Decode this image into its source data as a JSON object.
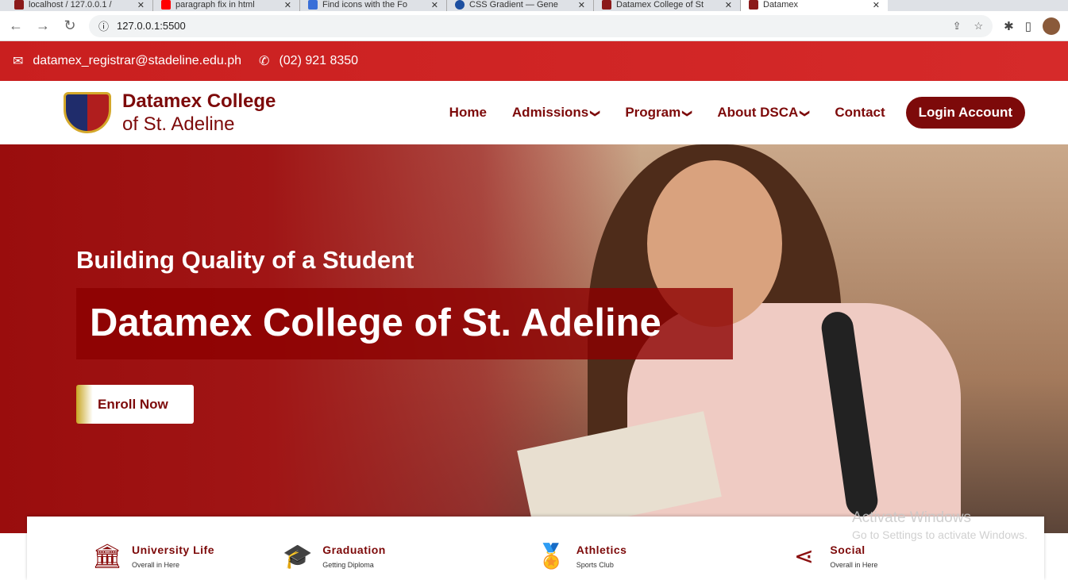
{
  "browser": {
    "tabs": [
      {
        "label": "localhost / 127.0.0.1 /"
      },
      {
        "label": "paragraph fix in html"
      },
      {
        "label": "Find icons with the Fo"
      },
      {
        "label": "CSS Gradient — Gene"
      },
      {
        "label": "Datamex College of St"
      },
      {
        "label": "Datamex",
        "active": true
      }
    ],
    "url": "127.0.0.1:5500"
  },
  "topbar": {
    "email": "datamex_registrar@stadeline.edu.ph",
    "phone": "(02) 921 8350"
  },
  "header": {
    "brand_line1": "Datamex College",
    "brand_line2": "of St. Adeline",
    "menu": [
      {
        "label": "Home"
      },
      {
        "label": "Admissions"
      },
      {
        "label": "Program"
      },
      {
        "label": "About DSCA"
      },
      {
        "label": "Contact"
      }
    ],
    "login": "Login Account"
  },
  "hero": {
    "subtitle": "Building Quality of a Student",
    "title": "Datamex College of St. Adeline",
    "cta": "Enroll Now"
  },
  "features": [
    {
      "title": "University Life",
      "sub": "Overall in Here",
      "icon": "university-icon"
    },
    {
      "title": "Graduation",
      "sub": "Getting Diploma",
      "icon": "graduation-cap-icon"
    },
    {
      "title": "Athletics",
      "sub": "Sports Club",
      "icon": "medal-icon"
    },
    {
      "title": "Social",
      "sub": "Overall in Here",
      "icon": "share-icon"
    }
  ],
  "watermark": {
    "line1": "Activate Windows",
    "line2": "Go to Settings to activate Windows."
  },
  "colors": {
    "brand": "#7d0a0a",
    "topbar": "#d62a2a"
  }
}
